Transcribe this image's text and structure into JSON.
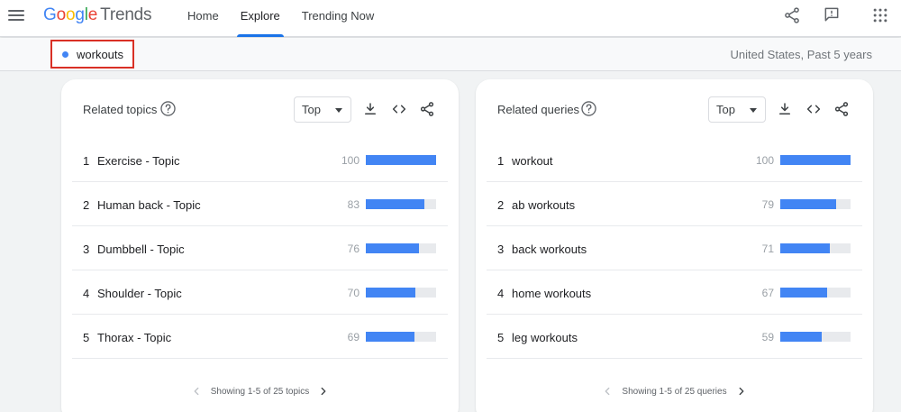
{
  "header": {
    "logo_google": "Google",
    "logo_trends": "Trends",
    "nav": [
      "Home",
      "Explore",
      "Trending Now"
    ],
    "active_nav": "Explore",
    "icons": [
      "share-icon",
      "feedback-icon",
      "apps-grid-icon"
    ]
  },
  "search": {
    "term": "workouts",
    "term_color": "#4285f4",
    "scope": "United States, Past 5 years"
  },
  "colors": {
    "bar": "#4285f4",
    "highlight_box": "#d93025",
    "nav_active": "#1a73e8"
  },
  "related_topics": {
    "title": "Related topics",
    "filter": "Top",
    "rows": [
      {
        "rank": "1",
        "name": "Exercise - Topic",
        "value": "100"
      },
      {
        "rank": "2",
        "name": "Human back - Topic",
        "value": "83"
      },
      {
        "rank": "3",
        "name": "Dumbbell - Topic",
        "value": "76"
      },
      {
        "rank": "4",
        "name": "Shoulder - Topic",
        "value": "70"
      },
      {
        "rank": "5",
        "name": "Thorax - Topic",
        "value": "69"
      }
    ],
    "pager": "Showing 1-5 of 25 topics"
  },
  "related_queries": {
    "title": "Related queries",
    "filter": "Top",
    "rows": [
      {
        "rank": "1",
        "name": "workout",
        "value": "100"
      },
      {
        "rank": "2",
        "name": "ab workouts",
        "value": "79"
      },
      {
        "rank": "3",
        "name": "back workouts",
        "value": "71"
      },
      {
        "rank": "4",
        "name": "home workouts",
        "value": "67"
      },
      {
        "rank": "5",
        "name": "leg workouts",
        "value": "59"
      }
    ],
    "pager": "Showing 1-5 of 25 queries"
  }
}
